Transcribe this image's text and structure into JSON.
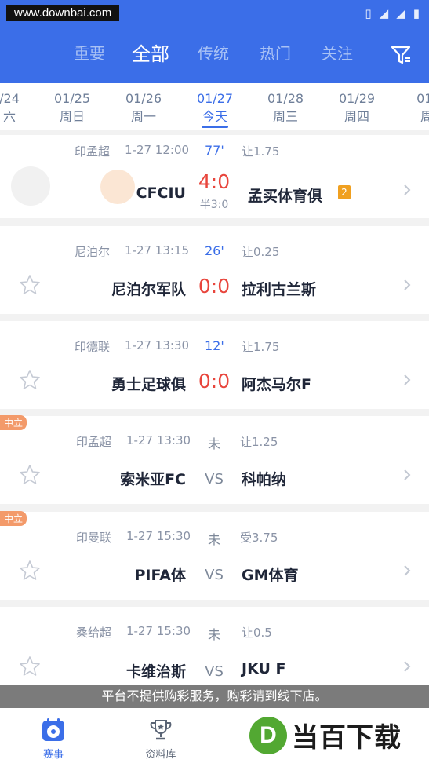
{
  "status_bar": {
    "site_label": "www.downbai.com"
  },
  "tabs": [
    {
      "label": "重要"
    },
    {
      "label": "全部",
      "active": true
    },
    {
      "label": "传统"
    },
    {
      "label": "热门"
    },
    {
      "label": "关注"
    }
  ],
  "filter_icon": "filter-icon",
  "dates": [
    {
      "date": "/24",
      "weekday": "六"
    },
    {
      "date": "01/25",
      "weekday": "周日"
    },
    {
      "date": "01/26",
      "weekday": "周一"
    },
    {
      "date": "01/27",
      "weekday": "今天",
      "active": true
    },
    {
      "date": "01/28",
      "weekday": "周三"
    },
    {
      "date": "01/29",
      "weekday": "周四"
    },
    {
      "date": "01/",
      "weekday": "周"
    }
  ],
  "matches": [
    {
      "league": "印孟超",
      "time": "1-27 12:00",
      "minute": "77'",
      "handicap": "让1.75",
      "home": "CFCIU",
      "away": "孟买体育俱",
      "score": "4:0",
      "halftime": "半3:0",
      "away_badge": "2"
    },
    {
      "league": "尼泊尔",
      "time": "1-27 13:15",
      "minute": "26'",
      "handicap": "让0.25",
      "home": "尼泊尔军队",
      "away": "拉利古兰斯",
      "score": "0:0"
    },
    {
      "league": "印德联",
      "time": "1-27 13:30",
      "minute": "12'",
      "handicap": "让1.75",
      "home": "勇士足球俱",
      "away": "阿杰马尔F",
      "score": "0:0"
    },
    {
      "league": "印孟超",
      "time": "1-27 13:30",
      "status": "未",
      "handicap": "让1.25",
      "home": "索米亚FC",
      "away": "科帕纳",
      "vs": "VS",
      "tag": "中立"
    },
    {
      "league": "印曼联",
      "time": "1-27 15:30",
      "status": "未",
      "handicap": "受3.75",
      "home": "PIFA体",
      "away": "GM体育",
      "vs": "VS",
      "tag": "中立"
    },
    {
      "league": "桑给超",
      "time": "1-27 15:30",
      "status": "未",
      "handicap": "让0.5",
      "home": "卡维治斯",
      "away": "JKU F",
      "vs": "VS"
    }
  ],
  "notice": "平台不提供购彩服务，购彩请到线下店。",
  "bottom_nav": [
    {
      "label": "赛事",
      "icon": "soccer-calendar-icon",
      "active": true
    },
    {
      "label": "资料库",
      "icon": "trophy-icon"
    }
  ],
  "watermark": {
    "logo_letter": "D",
    "text": "当百下载"
  },
  "colors": {
    "primary": "#3b6ee8",
    "score": "#e8453c",
    "neutral_tag": "#f39a6a",
    "badge": "#f0a020"
  }
}
